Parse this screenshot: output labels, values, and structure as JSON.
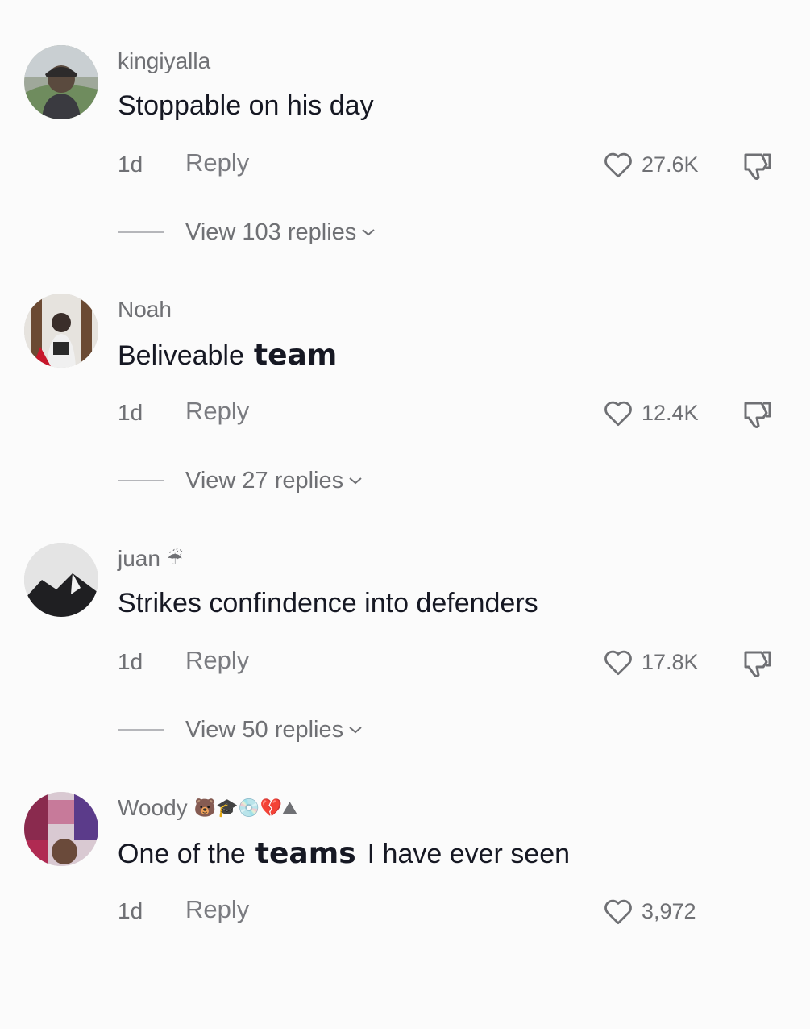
{
  "comments": [
    {
      "username": "kingiyalla",
      "username_emojis": "",
      "text_parts": [
        "Stoppable on his day"
      ],
      "age": "1d",
      "reply_label": "Reply",
      "likes": "27.6K",
      "view_replies": "View 103 replies"
    },
    {
      "username": "Noah",
      "username_emojis": "",
      "text_parts": [
        "Beliveable",
        "team"
      ],
      "age": "1d",
      "reply_label": "Reply",
      "likes": "12.4K",
      "view_replies": "View 27 replies"
    },
    {
      "username": "juan",
      "username_emojis": "☔",
      "text_parts": [
        "Strikes confindence into defenders"
      ],
      "age": "1d",
      "reply_label": "Reply",
      "likes": "17.8K",
      "view_replies": "View 50 replies"
    },
    {
      "username": "Woody",
      "username_emojis": "🐻🎓💿💔⛰",
      "text_parts": [
        "One of the",
        "teams",
        "I have ever seen"
      ],
      "age": "1d",
      "reply_label": "Reply",
      "likes": "3,972",
      "view_replies": ""
    }
  ],
  "icons": {
    "like": "heart-outline-icon",
    "dislike": "thumbs-down-icon",
    "expand": "chevron-down-icon"
  },
  "colors": {
    "background": "#fbfbfb",
    "primary_text": "#161823",
    "secondary_text": "#6f7074"
  }
}
